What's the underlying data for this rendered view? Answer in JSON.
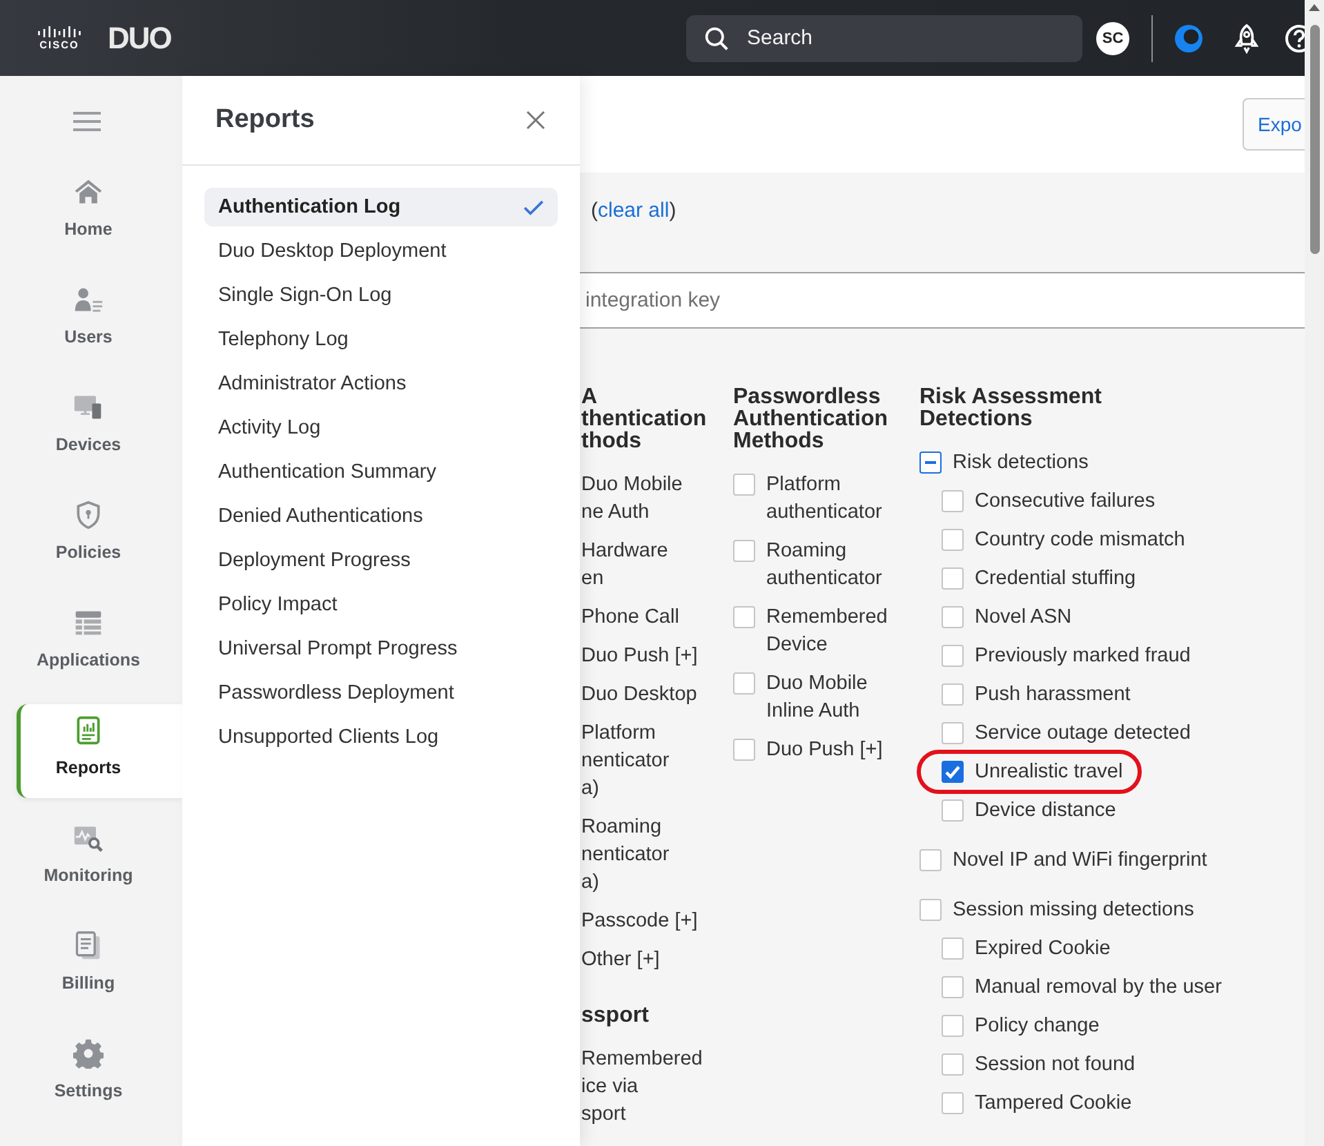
{
  "header": {
    "brand": "CISCO",
    "product": "DUO",
    "search": {
      "placeholder": "Search"
    },
    "avatar": "SC"
  },
  "nav": [
    {
      "label": "Home",
      "selected": false
    },
    {
      "label": "Users",
      "selected": false
    },
    {
      "label": "Devices",
      "selected": false
    },
    {
      "label": "Policies",
      "selected": false
    },
    {
      "label": "Applications",
      "selected": false
    },
    {
      "label": "Reports",
      "selected": true
    },
    {
      "label": "Monitoring",
      "selected": false
    },
    {
      "label": "Billing",
      "selected": false
    },
    {
      "label": "Settings",
      "selected": false
    }
  ],
  "reports_panel": {
    "title": "Reports",
    "items": [
      {
        "label": "Authentication Log",
        "selected": true
      },
      {
        "label": "Duo Desktop Deployment",
        "selected": false
      },
      {
        "label": "Single Sign-On Log",
        "selected": false
      },
      {
        "label": "Telephony Log",
        "selected": false
      },
      {
        "label": "Administrator Actions",
        "selected": false
      },
      {
        "label": "Activity Log",
        "selected": false
      },
      {
        "label": "Authentication Summary",
        "selected": false
      },
      {
        "label": "Denied Authentications",
        "selected": false
      },
      {
        "label": "Deployment Progress",
        "selected": false
      },
      {
        "label": "Policy Impact",
        "selected": false
      },
      {
        "label": "Universal Prompt Progress",
        "selected": false
      },
      {
        "label": "Passwordless Deployment",
        "selected": false
      },
      {
        "label": "Unsupported Clients Log",
        "selected": false
      }
    ]
  },
  "main": {
    "export_button": "Expo",
    "filters": {
      "prefix": "(",
      "link": "clear all",
      "suffix": ")"
    },
    "search": {
      "placeholder": "integration key"
    },
    "columns": [
      {
        "kind": "clipped",
        "sections": [
          {
            "heading": [
              "A",
              "thentication",
              "thods"
            ],
            "items": [
              [
                "Duo Mobile",
                "ne Auth"
              ],
              [
                "Hardware",
                "en"
              ],
              [
                "Phone Call"
              ],
              [
                "Duo Push [+]"
              ],
              [
                "Duo Desktop"
              ],
              [
                "Platform",
                "nenticator",
                "a)"
              ],
              [
                "Roaming",
                "nenticator",
                "a)"
              ],
              [
                "Passcode [+]"
              ],
              [
                "Other [+]"
              ]
            ]
          },
          {
            "heading": [
              "ssport"
            ],
            "items": [
              [
                "Remembered",
                "ice via",
                "sport"
              ]
            ]
          }
        ]
      },
      {
        "kind": "inline",
        "heading": "Passwordless Authentication Methods",
        "items": [
          {
            "label": "Platform authenticator",
            "checked": false
          },
          {
            "label": "Roaming authenticator",
            "checked": false
          },
          {
            "label": "Remembered Device",
            "checked": false
          },
          {
            "label": "Duo Mobile Inline Auth",
            "checked": false
          },
          {
            "label": "Duo Push [+]",
            "checked": false
          }
        ]
      },
      {
        "kind": "tree",
        "heading": "Risk Assessment Detections",
        "items": [
          {
            "label": "Risk detections",
            "checked": false,
            "mixed": true,
            "children": [
              {
                "label": "Consecutive failures",
                "checked": false,
                "highlighted": false
              },
              {
                "label": "Country code mismatch",
                "checked": false,
                "highlighted": false
              },
              {
                "label": "Credential stuffing",
                "checked": false,
                "highlighted": false
              },
              {
                "label": "Novel ASN",
                "checked": false,
                "highlighted": false
              },
              {
                "label": "Previously marked fraud",
                "checked": false,
                "highlighted": false
              },
              {
                "label": "Push harassment",
                "checked": false,
                "highlighted": false
              },
              {
                "label": "Service outage detected",
                "checked": false,
                "highlighted": false
              },
              {
                "label": "Unrealistic travel",
                "checked": true,
                "highlighted": true
              },
              {
                "label": "Device distance",
                "checked": false,
                "highlighted": false
              }
            ]
          },
          {
            "label": "Novel IP and WiFi fingerprint",
            "checked": false,
            "mixed": false
          },
          {
            "label": "Session missing detections",
            "checked": false,
            "mixed": false,
            "children": [
              {
                "label": "Expired Cookie",
                "checked": false
              },
              {
                "label": "Manual removal by the user",
                "checked": false
              },
              {
                "label": "Policy change",
                "checked": false
              },
              {
                "label": "Session not found",
                "checked": false
              },
              {
                "label": "Tampered Cookie",
                "checked": false
              }
            ]
          }
        ]
      }
    ]
  }
}
